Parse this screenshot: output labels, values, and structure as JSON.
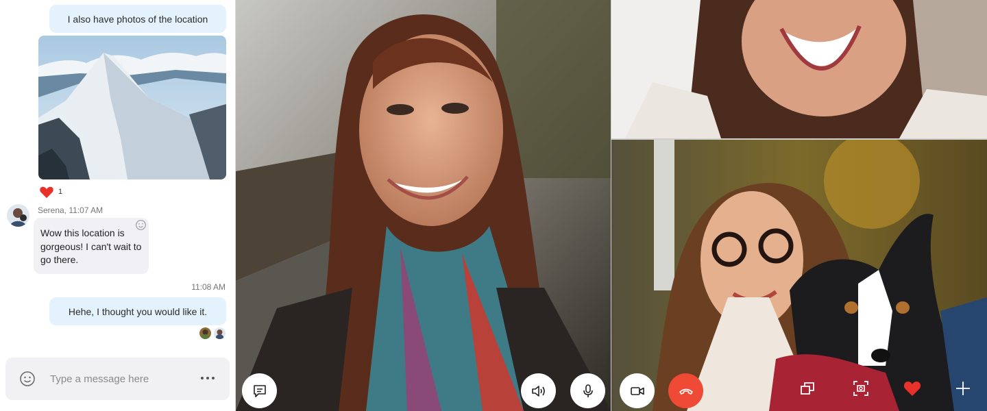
{
  "chat": {
    "messages": {
      "out_1": "I also have photos of the location",
      "reaction_count": "1",
      "sender_meta": "Serena, 11:07 AM",
      "in_1": "Wow this location is gorgeous! I can't wait to go there.",
      "time_2": "11:08 AM",
      "out_2": "Hehe, I thought you would like it."
    },
    "composer": {
      "placeholder": "Type a message here"
    }
  },
  "colors": {
    "bubble_out": "#e3f2fc",
    "bubble_in": "#f1f1f5",
    "end_call": "#ee4a36",
    "heart": "#e8312a"
  },
  "icons": {
    "chat_toggle": "chat-icon",
    "speaker": "speaker-icon",
    "mic": "microphone-icon",
    "camera": "video-camera-icon",
    "end_call": "hang-up-icon",
    "switch_view": "switch-view-icon",
    "snapshot": "snapshot-icon",
    "reaction": "heart-icon",
    "more": "plus-icon"
  }
}
